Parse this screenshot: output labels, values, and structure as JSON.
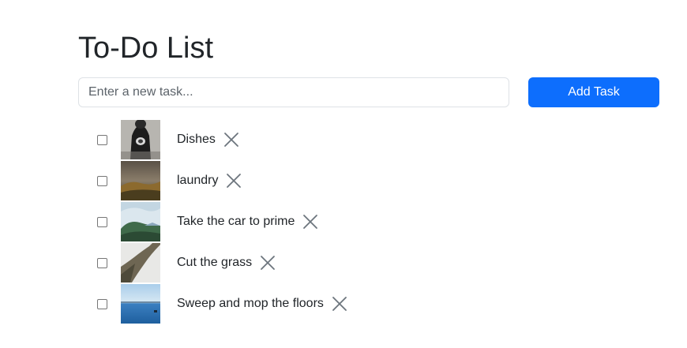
{
  "page": {
    "title": "To-Do List"
  },
  "form": {
    "input_placeholder": "Enter a new task...",
    "input_value": "",
    "add_button_label": "Add Task"
  },
  "colors": {
    "primary": "#0d6efd",
    "text": "#212529",
    "delete_icon": "#6c757d"
  },
  "tasks": [
    {
      "label": "Dishes",
      "checked": false,
      "thumbnail": "person-dark-clothing-photo"
    },
    {
      "label": "laundry",
      "checked": false,
      "thumbnail": "foggy-hillside-photo"
    },
    {
      "label": "Take the car to prime",
      "checked": false,
      "thumbnail": "mountain-forest-sky-photo"
    },
    {
      "label": "Cut the grass",
      "checked": false,
      "thumbnail": "misty-slope-photo"
    },
    {
      "label": "Sweep and mop the floors",
      "checked": false,
      "thumbnail": "blue-sea-photo"
    }
  ]
}
